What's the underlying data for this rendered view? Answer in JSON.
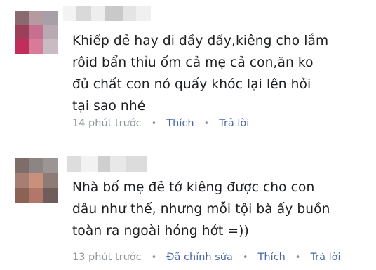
{
  "comments": [
    {
      "text": "Khiếp đẻ hay đi đầy đấy,kiêng cho lắm\nrôid bẩn thỉu ốm cả mẹ cả con,ăn ko\nđủ chất con nó quấy khóc lại lên hỏi\ntại sao nhé",
      "time": "14 phút trước",
      "separator": "•",
      "actions": [
        "Thích",
        "Trả lời"
      ]
    },
    {
      "text": "Nhà bố mẹ đẻ tớ kiêng được cho con\ndâu như thế, nhưng mỗi tội bà ấy buồn\ntoàn ra ngoài hóng hớt =))",
      "time": "13 phút trước",
      "separator": "•",
      "edited_label": "Đã chỉnh sửa",
      "actions": [
        "Thích",
        "Trả lời"
      ]
    }
  ],
  "colors": {
    "comment_text": "#1c1e21",
    "meta_text": "#90949c",
    "link": "#4b67a8"
  }
}
